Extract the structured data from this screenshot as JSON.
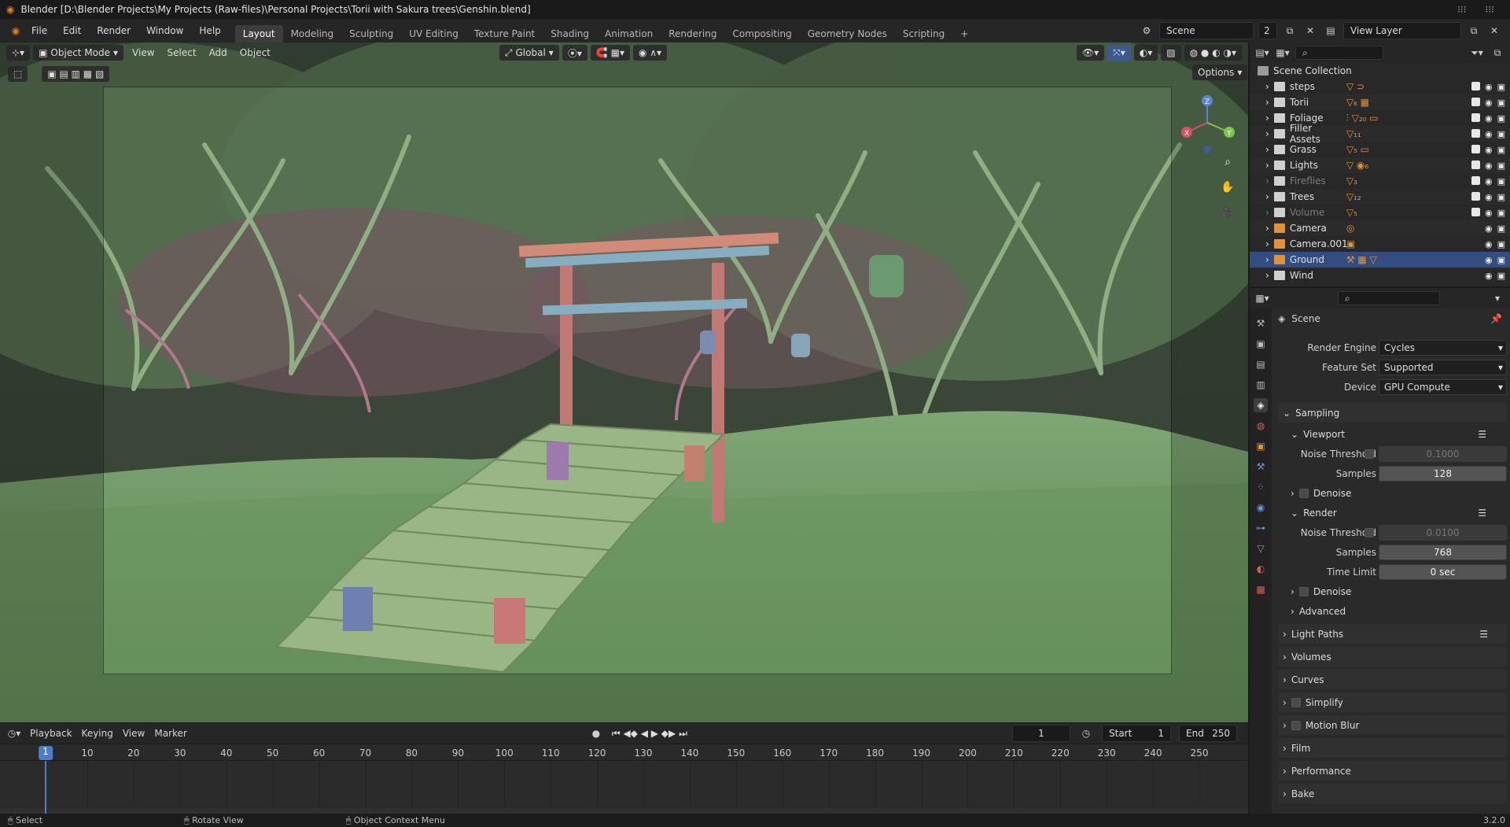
{
  "titlebar": {
    "title": "Blender [D:\\Blender Projects\\My Projects (Raw-files)\\Personal Projects\\Torii with Sakura trees\\Genshin.blend]"
  },
  "topbar": {
    "menus": [
      "File",
      "Edit",
      "Render",
      "Window",
      "Help"
    ],
    "workspaces": [
      "Layout",
      "Modeling",
      "Sculpting",
      "UV Editing",
      "Texture Paint",
      "Shading",
      "Animation",
      "Rendering",
      "Compositing",
      "Geometry Nodes",
      "Scripting"
    ],
    "active_workspace": "Layout",
    "add_tab": "+",
    "scene_name": "Scene",
    "scene_users": "2",
    "view_layer": "View Layer"
  },
  "viewport": {
    "mode": "Object Mode",
    "menus": [
      "View",
      "Select",
      "Add",
      "Object"
    ],
    "transform_orientation": "Global",
    "options_label": "Options",
    "gizmo": {
      "x": "X",
      "y": "Y",
      "z": "Z"
    }
  },
  "timeline": {
    "menus": [
      "Playback",
      "Keying",
      "View",
      "Marker"
    ],
    "current_frame": "1",
    "start_label": "Start",
    "start": "1",
    "end_label": "End",
    "end": "250",
    "ticks": [
      "1",
      "10",
      "20",
      "30",
      "40",
      "50",
      "60",
      "70",
      "80",
      "90",
      "100",
      "110",
      "120",
      "130",
      "140",
      "150",
      "160",
      "170",
      "180",
      "190",
      "200",
      "210",
      "220",
      "230",
      "240",
      "250"
    ]
  },
  "outliner": {
    "root": "Scene Collection",
    "items": [
      {
        "name": "steps",
        "dim": false,
        "sel": false,
        "icons": "▽ ⊃"
      },
      {
        "name": "Torii",
        "dim": false,
        "sel": false,
        "icons": "▽₆ ▦"
      },
      {
        "name": "Foliage",
        "dim": false,
        "sel": false,
        "icons": "⫶ ▽₂₀ ▭"
      },
      {
        "name": "Filler Assets",
        "dim": false,
        "sel": false,
        "icons": "▽₁₁"
      },
      {
        "name": "Grass",
        "dim": false,
        "sel": false,
        "icons": "▽₅ ▭"
      },
      {
        "name": "Lights",
        "dim": false,
        "sel": false,
        "icons": "▽ ◉₆"
      },
      {
        "name": "Fireflies",
        "dim": true,
        "sel": false,
        "icons": "▽₃"
      },
      {
        "name": "Trees",
        "dim": false,
        "sel": false,
        "icons": "▽₁₂"
      },
      {
        "name": "Volume",
        "dim": true,
        "sel": false,
        "icons": "▽₅"
      },
      {
        "name": "Camera",
        "dim": false,
        "sel": false,
        "icons": "◎"
      },
      {
        "name": "Camera.001",
        "dim": false,
        "sel": false,
        "icons": "▣"
      },
      {
        "name": "Ground",
        "dim": false,
        "sel": true,
        "icons": "⚒ ▦ ▽"
      },
      {
        "name": "Wind",
        "dim": false,
        "sel": false,
        "icons": ""
      }
    ]
  },
  "properties": {
    "context": "Scene",
    "render_engine_label": "Render Engine",
    "render_engine": "Cycles",
    "feature_set_label": "Feature Set",
    "feature_set": "Supported",
    "device_label": "Device",
    "device": "GPU Compute",
    "sampling": "Sampling",
    "viewport": "Viewport",
    "noise_threshold_label": "Noise Threshold",
    "vp_noise_threshold": "0.1000",
    "samples_label": "Samples",
    "vp_samples": "128",
    "denoise": "Denoise",
    "render": "Render",
    "r_noise_threshold": "0.0100",
    "r_samples": "768",
    "time_limit_label": "Time Limit",
    "time_limit": "0 sec",
    "advanced": "Advanced",
    "panels": [
      "Light Paths",
      "Volumes",
      "Curves",
      "Simplify",
      "Motion Blur",
      "Film",
      "Performance",
      "Bake"
    ]
  },
  "status": {
    "select": "Select",
    "rotate": "Rotate View",
    "context": "Object Context Menu",
    "version": "3.2.0"
  }
}
